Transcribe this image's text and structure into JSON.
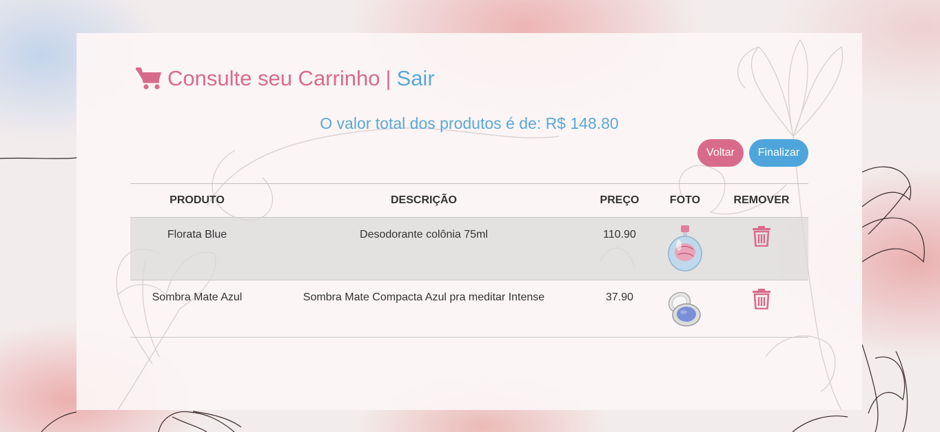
{
  "header": {
    "title": "Consulte seu Carrinho",
    "separator": "|",
    "logout_label": "Sair",
    "cart_icon": "shopping-cart-icon"
  },
  "summary": {
    "total_text": "O valor total dos produtos é de: R$ 148.80"
  },
  "actions": {
    "back_label": "Voltar",
    "finish_label": "Finalizar"
  },
  "table": {
    "columns": [
      "PRODUTO",
      "DESCRIÇÃO",
      "PREÇO",
      "FOTO",
      "REMOVER"
    ],
    "rows": [
      {
        "product": "Florata Blue",
        "description": "Desodorante colônia 75ml",
        "price": "110.90",
        "photo": "perfume-bottle-image",
        "remove_icon": "trash-icon"
      },
      {
        "product": "Sombra Mate Azul",
        "description": "Sombra Mate Compacta Azul pra meditar Intense",
        "price": "37.90",
        "photo": "eyeshadow-compact-image",
        "remove_icon": "trash-icon"
      }
    ]
  },
  "colors": {
    "pink_accent": "#d86b8c",
    "blue_accent": "#5aa8d8",
    "finish_button": "#4ea5dc"
  }
}
